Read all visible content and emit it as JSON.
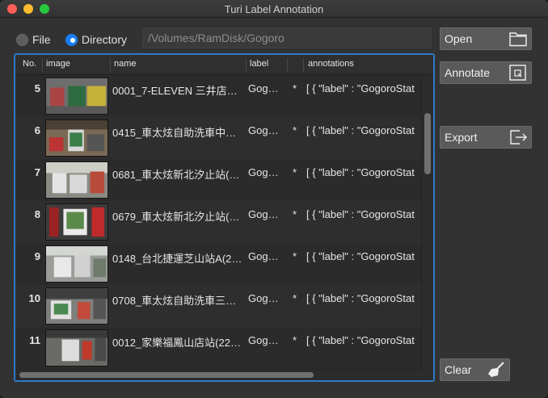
{
  "window": {
    "title": "Turi Label Annotation"
  },
  "source": {
    "file_label": "File",
    "directory_label": "Directory",
    "selected": "directory",
    "path": "/Volumes/RamDisk/Gogoro"
  },
  "buttons": {
    "open": "Open",
    "annotate": "Annotate",
    "export": "Export",
    "clear": "Clear"
  },
  "table": {
    "columns": [
      "No.",
      "image",
      "name",
      "label",
      "annotations"
    ],
    "rows": [
      {
        "no": "5",
        "name": "0001_7-ELEVEN 三井店…",
        "label": "Gog…",
        "star": "*",
        "annotations": "[ { \"label\" : \"GogoroStat"
      },
      {
        "no": "6",
        "name": "0415_車太炫自助洗車中…",
        "label": "Gog…",
        "star": "*",
        "annotations": "[ { \"label\" : \"GogoroStat"
      },
      {
        "no": "7",
        "name": "0681_車太炫新北汐止站(…",
        "label": "Gog…",
        "star": "*",
        "annotations": "[ { \"label\" : \"GogoroStat"
      },
      {
        "no": "8",
        "name": "0679_車太炫新北汐止站(…",
        "label": "Gog…",
        "star": "*",
        "annotations": "[ { \"label\" : \"GogoroStat"
      },
      {
        "no": "9",
        "name": "0148_台北捷運芝山站A(2…",
        "label": "Gog…",
        "star": "*",
        "annotations": "[ { \"label\" : \"GogoroStat"
      },
      {
        "no": "10",
        "name": "0708_車太炫自助洗車三…",
        "label": "Gog…",
        "star": "*",
        "annotations": "[ { \"label\" : \"GogoroStat"
      },
      {
        "no": "11",
        "name": "0012_家樂福鳳山店站(22…",
        "label": "Gog…",
        "star": "*",
        "annotations": "[ { \"label\" : \"GogoroStat"
      }
    ]
  },
  "colors": {
    "accent": "#2f78c9",
    "radio_selected": "#1a7ff5"
  }
}
